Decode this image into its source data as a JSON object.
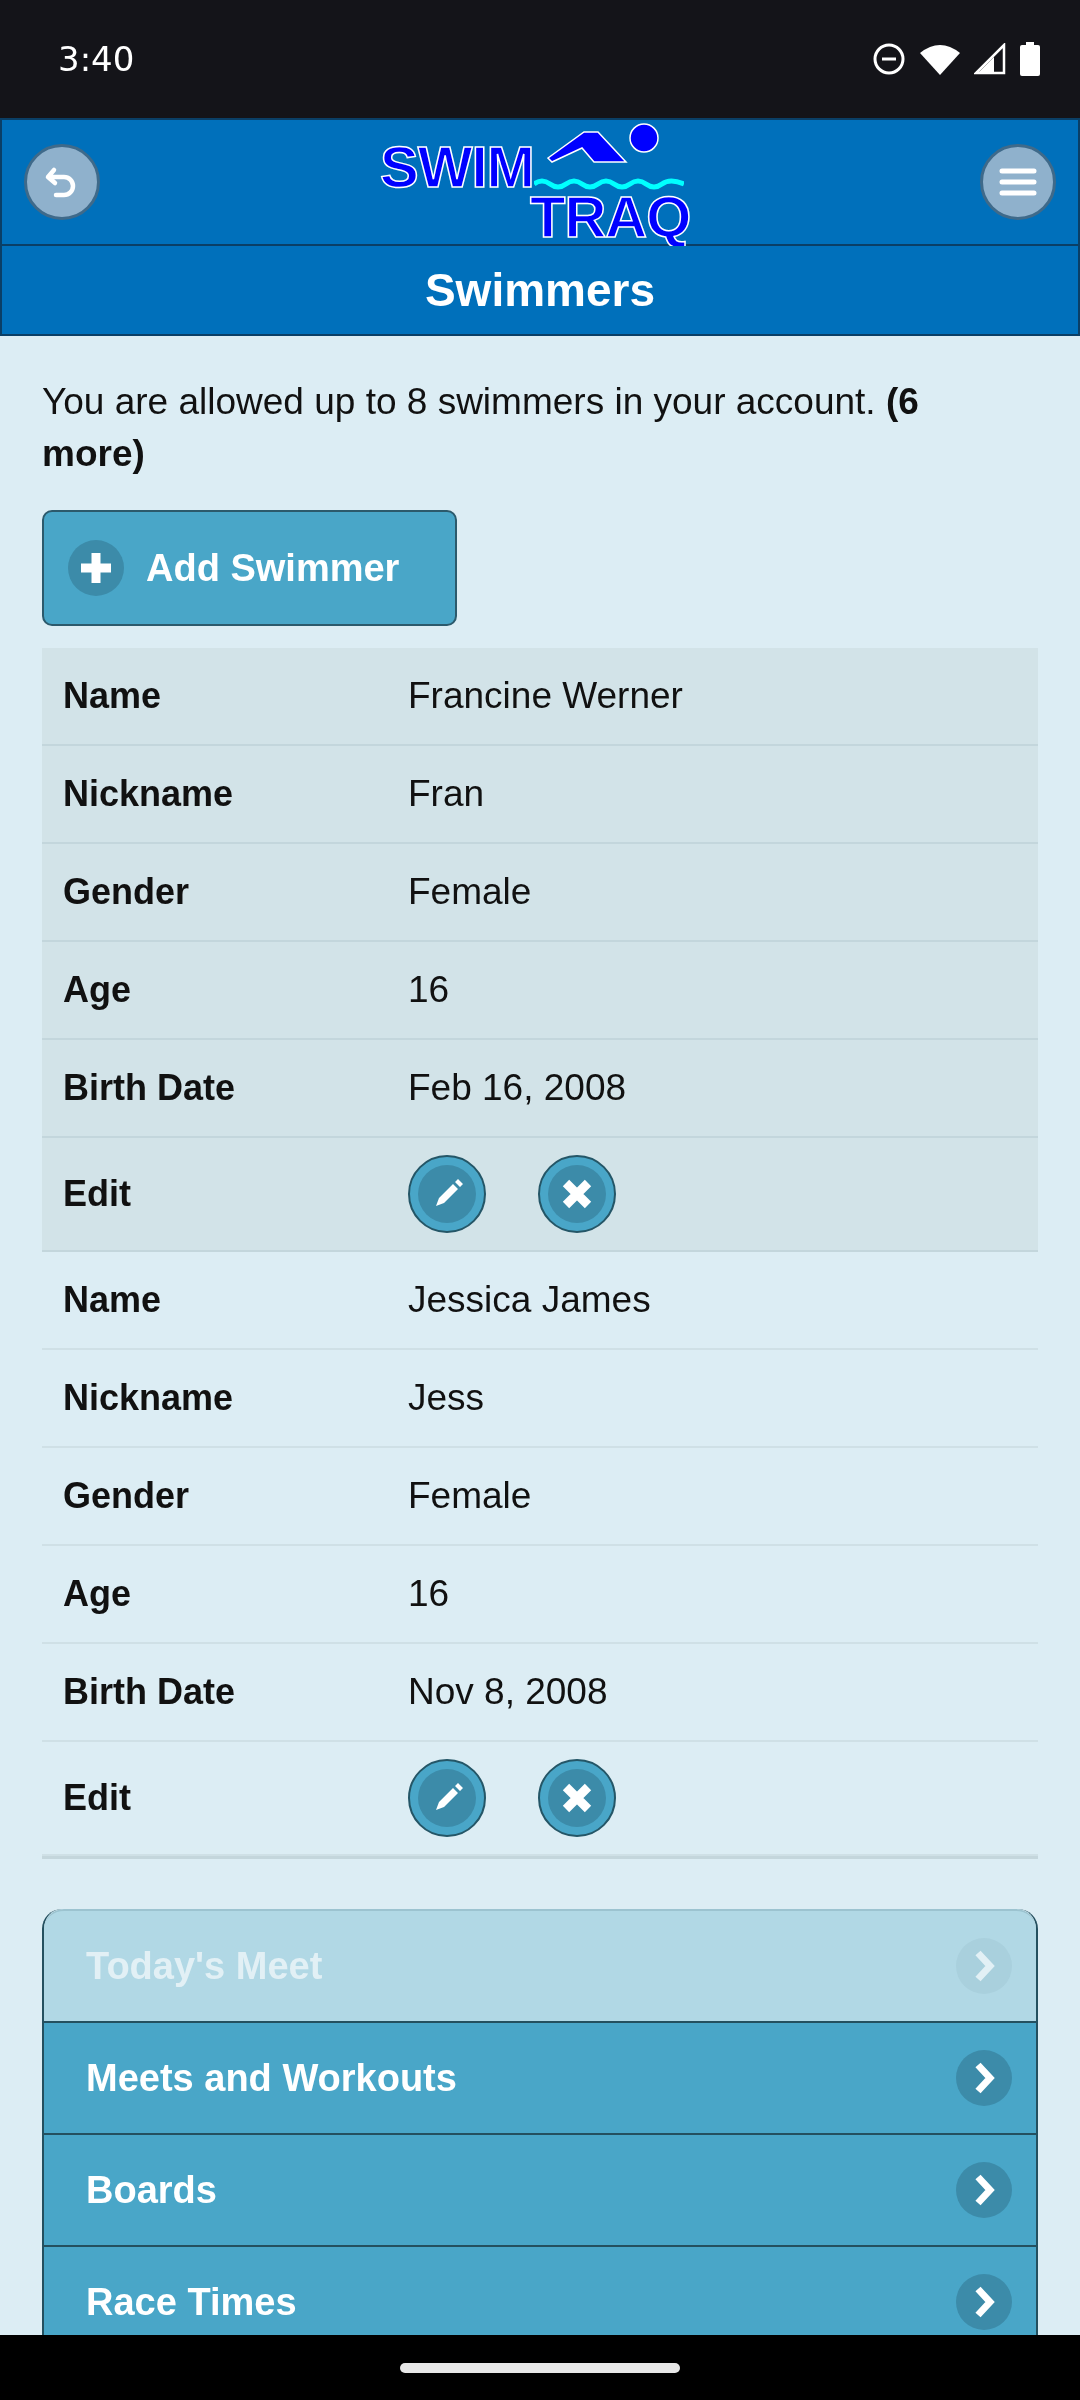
{
  "status_bar": {
    "time": "3:40"
  },
  "header": {
    "logo": {
      "top": "SWIM",
      "bottom": "TRAQ"
    }
  },
  "title": "Swimmers",
  "notice": "You are allowed up to 8 swimmers in your account. **(6 more)**",
  "add_button": "Add Swimmer",
  "swimmers": [
    {
      "shaded": true,
      "fields": [
        {
          "label": "Name",
          "value": "Francine Werner"
        },
        {
          "label": "Nickname",
          "value": "Fran"
        },
        {
          "label": "Gender",
          "value": "Female"
        },
        {
          "label": "Age",
          "value": "16"
        },
        {
          "label": "Birth Date",
          "value": "Feb 16, 2008"
        }
      ],
      "edit_label": "Edit"
    },
    {
      "shaded": false,
      "fields": [
        {
          "label": "Name",
          "value": "Jessica James"
        },
        {
          "label": "Nickname",
          "value": "Jess"
        },
        {
          "label": "Gender",
          "value": "Female"
        },
        {
          "label": "Age",
          "value": "16"
        },
        {
          "label": "Birth Date",
          "value": "Nov 8, 2008"
        }
      ],
      "edit_label": "Edit"
    }
  ],
  "menu": [
    {
      "label": "Today's Meet",
      "disabled": true
    },
    {
      "label": "Meets and Workouts",
      "disabled": false
    },
    {
      "label": "Boards",
      "disabled": false
    },
    {
      "label": "Race Times",
      "disabled": false
    }
  ]
}
